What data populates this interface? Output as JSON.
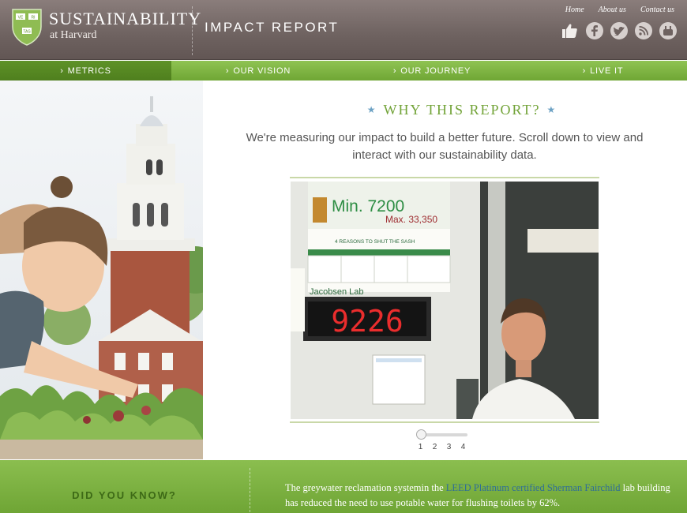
{
  "header": {
    "logo_line1": "SUSTAINABILITY",
    "logo_line2": "at Harvard",
    "shield_motto": "VE RI TAS",
    "report_title": "IMPACT REPORT",
    "top_links": [
      "Home",
      "About us",
      "Contact us"
    ],
    "social_icons": [
      "thumbs-up-icon",
      "facebook-icon",
      "twitter-icon",
      "rss-icon",
      "youtube-icon"
    ]
  },
  "nav": {
    "items": [
      {
        "label": "METRICS",
        "active": true
      },
      {
        "label": "OUR VISION",
        "active": false
      },
      {
        "label": "OUR JOURNEY",
        "active": false
      },
      {
        "label": "LIVE IT",
        "active": false
      }
    ]
  },
  "main": {
    "heading": "WHY THIS REPORT?",
    "intro": "We're measuring our impact to build a better future. Scroll down to view and interact with our sustainability data.",
    "slideshow": {
      "sign_min": "Min. 7200",
      "sign_max": "Max. 33,350",
      "sign_subtitle": "4 REASONS TO SHUT THE SASH",
      "sign_lab": "Jacobsen Lab",
      "counter": "9226",
      "pages": [
        "1",
        "2",
        "3",
        "4"
      ],
      "current_page": 1
    }
  },
  "footer": {
    "label": "DID YOU KNOW?",
    "fact_before": "The greywater reclamation systemin the ",
    "fact_link": "LEED Platinum certified Sherman Fairchild",
    "fact_after": " lab building has reduced the need to use potable water for flushing toilets by 62%."
  },
  "colors": {
    "header": "#6e6260",
    "nav_green": "#7fb443",
    "nav_active": "#5a8b25",
    "heading_green": "#72a338",
    "link_blue": "#2f6e97"
  }
}
